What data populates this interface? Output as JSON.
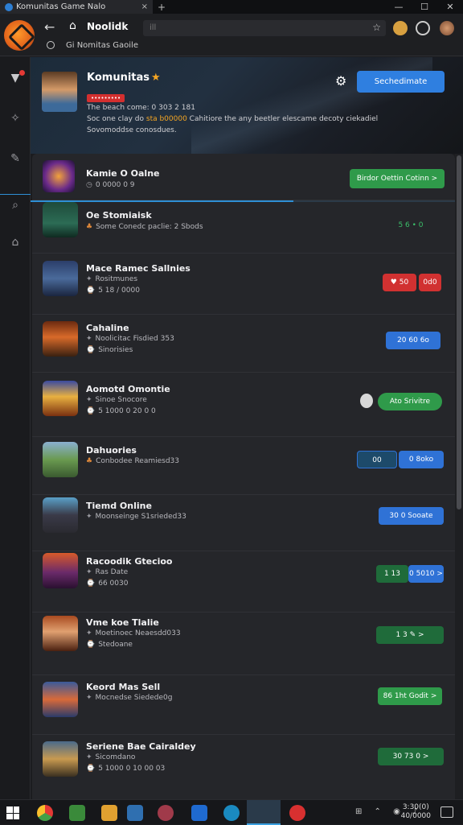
{
  "titlebar": {
    "tab_title": "Komunitas Game Nalo",
    "close": "×",
    "new_tab": "+",
    "minimize": "—",
    "maximize": "☐",
    "window_close": "✕"
  },
  "nav": {
    "back": "←",
    "home": "⌂",
    "title": "Noolidk",
    "address": "ill",
    "subtitle": "Gi Nomitas Gaoile"
  },
  "hero": {
    "name": "Komunitas",
    "stars": "★",
    "badge": "•••••••••",
    "line1": "The beach come: 0 303 2 181",
    "line2_a": "Soc one clay do ",
    "line2_hi": "sta b00000",
    "line2_b": " Cahitiore the any beetler elescame decoty ciekadiel",
    "line3": "Sovomoddse conosdues.",
    "button": "Sechedimate"
  },
  "featured": {
    "title": "Kamie O Oalne",
    "sub": "0 0000 0 9",
    "button": "Birdor Oettin Cotinn >"
  },
  "rows": [
    {
      "title": "Oe Stomiaisk",
      "sub1": "Some Conedc paclie: 2 Sbods",
      "sub2": "",
      "action": "5 6  •  0",
      "action2": ""
    },
    {
      "title": "Mace Ramec Sallnies",
      "sub1": "Rositmunes",
      "sub2": "5 18 / 0000",
      "action": "♥ 50",
      "action2": "0d0"
    },
    {
      "title": "Cahaline",
      "sub1": "Noolicitac Fisdied 353",
      "sub2": "Sinorisies",
      "action": "20  60  6o",
      "action2": ""
    },
    {
      "title": "Aomotd Omontie",
      "sub1": "Sinoe Snocore",
      "sub2": "5 1000 0 20 0 0",
      "action": "Ato Srivitre",
      "action2": ""
    },
    {
      "title": "Dahuories",
      "sub1": "Conbodee Reamiesd33",
      "sub2": "",
      "action": "00",
      "action2": "0 8oko"
    },
    {
      "title": "Tiemd Online",
      "sub1": "Moonseinge S1srieded33",
      "sub2": "",
      "action": "30 0 Sooate",
      "action2": ""
    },
    {
      "title": "Racoodik Gtecioo",
      "sub1": "Ras Date",
      "sub2": "66 0030",
      "action": "1 13",
      "action2": "0 5010 >"
    },
    {
      "title": "Vme koe Tlalie",
      "sub1": "Moetinoec Neaesdd033",
      "sub2": "Stedoane",
      "action": "1 3  ✎ >",
      "action2": ""
    },
    {
      "title": "Keord Mas Sell",
      "sub1": "Mocnedse Siedede0g",
      "sub2": "",
      "action": "86 1ht Godit >",
      "action2": ""
    },
    {
      "title": "Seriene Bae Cairaldey",
      "sub1": "Sicomdano",
      "sub2": "5 1000 0 10 00 03",
      "action": "30 73 0 >",
      "action2": ""
    }
  ],
  "taskbar": {
    "time": "3:30(0)",
    "date": "40/0000"
  }
}
